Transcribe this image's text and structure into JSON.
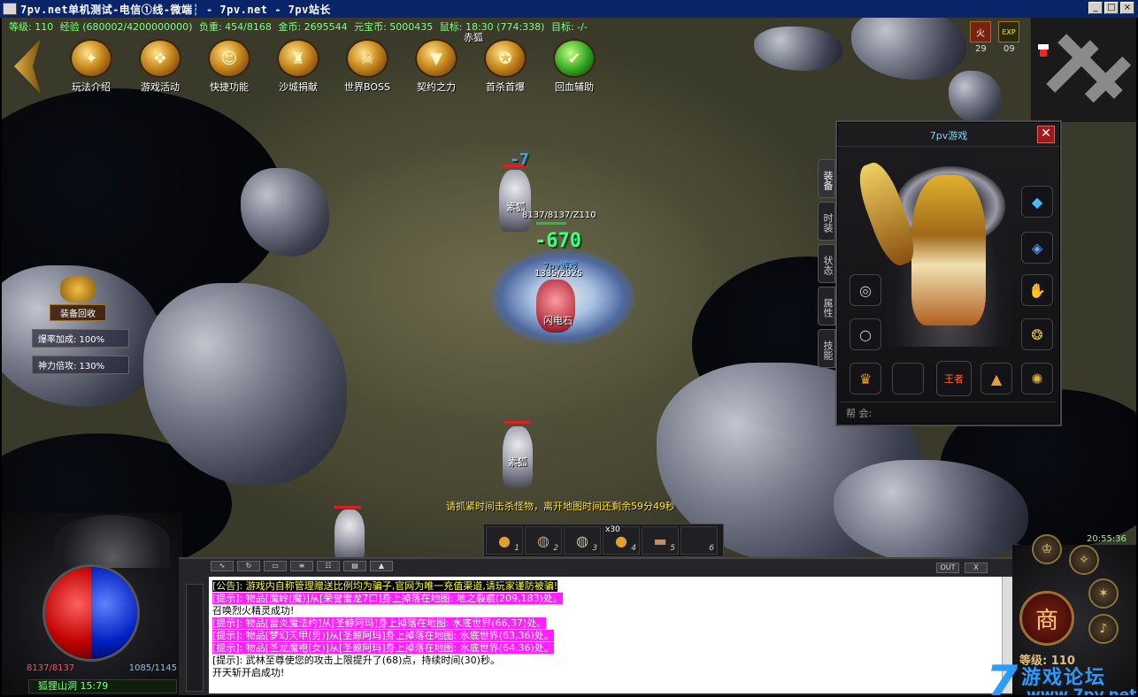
{
  "window": {
    "title": "7pv.net单机测试-电信①线-微端┆ - 7pv.net - 7pv站长",
    "buttons": [
      "_",
      "□",
      "×"
    ]
  },
  "stats": {
    "level": "等级: 110",
    "exp": "经验 (680002/4200000000)",
    "weight": "负重: 454/8168",
    "gold": "金币: 2695544",
    "ingot": "元宝币: 5000435",
    "mouse": "鼠标: 18:30 (774:338)",
    "target": "目标: -/-"
  },
  "menu": [
    {
      "label": "玩法介绍",
      "icon": "scroll-icon"
    },
    {
      "label": "游戏活动",
      "icon": "gift-icon"
    },
    {
      "label": "快捷功能",
      "icon": "portrait-icon"
    },
    {
      "label": "沙城捐献",
      "icon": "castle-icon"
    },
    {
      "label": "世界BOSS",
      "icon": "boss-icon"
    },
    {
      "label": "契约之力",
      "icon": "shield-icon"
    },
    {
      "label": "首杀首爆",
      "icon": "emblem-icon"
    },
    {
      "label": "回血辅助",
      "icon": "check-icon"
    }
  ],
  "buffs": [
    {
      "label": "火",
      "count": "29"
    },
    {
      "label": "EXP",
      "count": "09"
    }
  ],
  "side_panel": {
    "recycle_label": "装备回收",
    "drop_rate": "爆率加成: 100%",
    "power_mult": "神力倍攻: 130%"
  },
  "entities": [
    {
      "name": "赤狐",
      "kind": "monster"
    },
    {
      "name": "素狐",
      "kind": "monster",
      "hp": "8137/8137/Z110"
    },
    {
      "name": "素狐",
      "kind": "monster"
    },
    {
      "name": "7pv游戏",
      "kind": "player",
      "hp": "1335/2925"
    },
    {
      "name": "闪电石",
      "kind": "item"
    }
  ],
  "damage_numbers": [
    "-7",
    "-670"
  ],
  "equipment": {
    "title": "7pv游戏",
    "tabs": [
      "装备",
      "时装",
      "状态",
      "属性",
      "技能"
    ],
    "guild_label": "帮 会:",
    "slots": [
      "bracelet-icon",
      "crystal-icon",
      "ring-icon",
      "glove-icon",
      "ring2-icon",
      "amulet-icon",
      "helmet-icon",
      "empty",
      "medal-icon",
      "boots-icon",
      "gem-icon"
    ],
    "medal_text": "王者"
  },
  "hint": "请抓紧时间击杀怪物，离开地图时间还剩余59分49秒",
  "belt": [
    {
      "slot": "1",
      "icon": "potion-icon"
    },
    {
      "slot": "2",
      "icon": "scroll-icon"
    },
    {
      "slot": "3",
      "icon": "scroll-icon"
    },
    {
      "slot": "4",
      "icon": "potion-icon",
      "qty": "x30"
    },
    {
      "slot": "5",
      "icon": "book-icon"
    },
    {
      "slot": "6",
      "icon": "empty"
    }
  ],
  "orb": {
    "hp": "8137/8137",
    "mp": "1085/1145",
    "location": "狐狸山洞 15:79"
  },
  "chat": {
    "out_label": "OUT",
    "x_label": "X",
    "lines": [
      {
        "text": "[公告]: 游戏内自称管理赠送比例均为骗子,官网为唯一充值渠道,请玩家谨防被骗!",
        "style": "ann"
      },
      {
        "text": "[提示]: 物品[魔岭(魔)]从[荣誉雷龙7口]身上掉落在地图: 地之裂痕(209,183)处。",
        "style": "mag"
      },
      {
        "text": "召唤烈火精灵成功!",
        "style": "plain"
      },
      {
        "text": "[提示]: 物品[雷炎魔法约]从[圣鲸阿玛]身上掉落在地图: 水底世界(66,37)处。",
        "style": "mag"
      },
      {
        "text": "[提示]: 物品[梦幻天甲(男)]从[圣鲸阿玛]身上掉落在地图: 水底世界(63,36)处。",
        "style": "mag"
      },
      {
        "text": "[提示]: 物品[圣龙魔袍(女)]从[圣鲸阿玛]身上掉落在地图: 水底世界(64,36)处。",
        "style": "mag"
      },
      {
        "text": "[提示]: 武林至尊使您的攻击上限提升了(68)点，持续时间(30)秒。",
        "style": "plain"
      },
      {
        "text": "开天斩开启成功!",
        "style": "plain"
      }
    ]
  },
  "right_hud": {
    "clock": "20:55:36",
    "shop": "商",
    "level": "等级: 110"
  },
  "watermark": {
    "seven": "7",
    "forum": "游戏论坛",
    "site": "www.7pv.net"
  }
}
